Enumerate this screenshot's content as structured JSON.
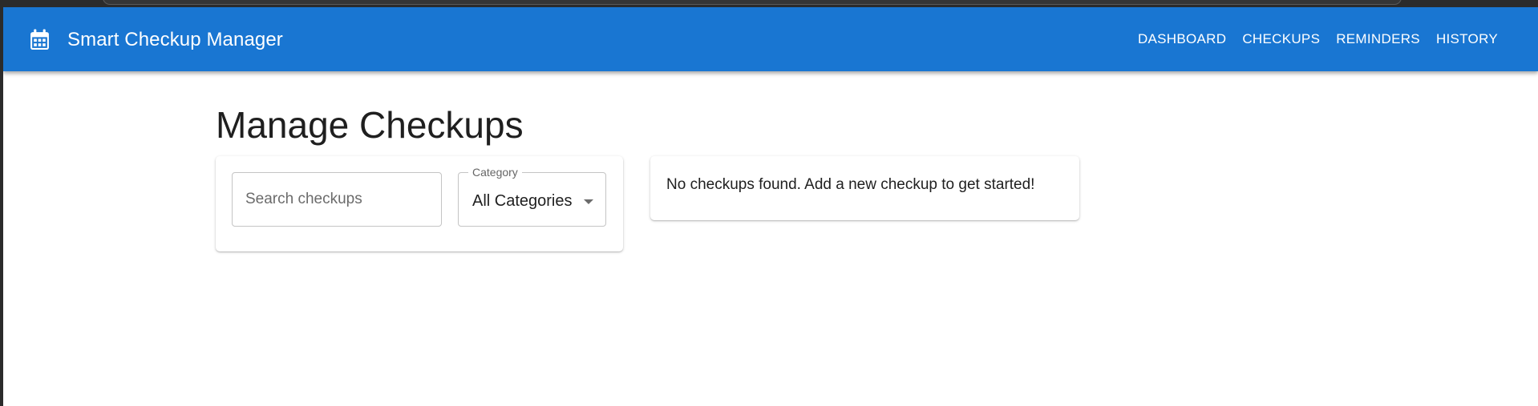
{
  "app": {
    "title": "Smart Checkup Manager",
    "brand_icon": "calendar-icon",
    "accent_color": "#1976d2"
  },
  "nav": {
    "items": [
      {
        "label": "DASHBOARD"
      },
      {
        "label": "CHECKUPS"
      },
      {
        "label": "REMINDERS"
      },
      {
        "label": "HISTORY"
      }
    ]
  },
  "page": {
    "heading": "Manage Checkups"
  },
  "filters": {
    "search": {
      "placeholder": "Search checkups",
      "value": ""
    },
    "category": {
      "label": "Category",
      "selected": "All Categories"
    }
  },
  "checkups": {
    "empty_message": "No checkups found. Add a new checkup to get started!"
  }
}
